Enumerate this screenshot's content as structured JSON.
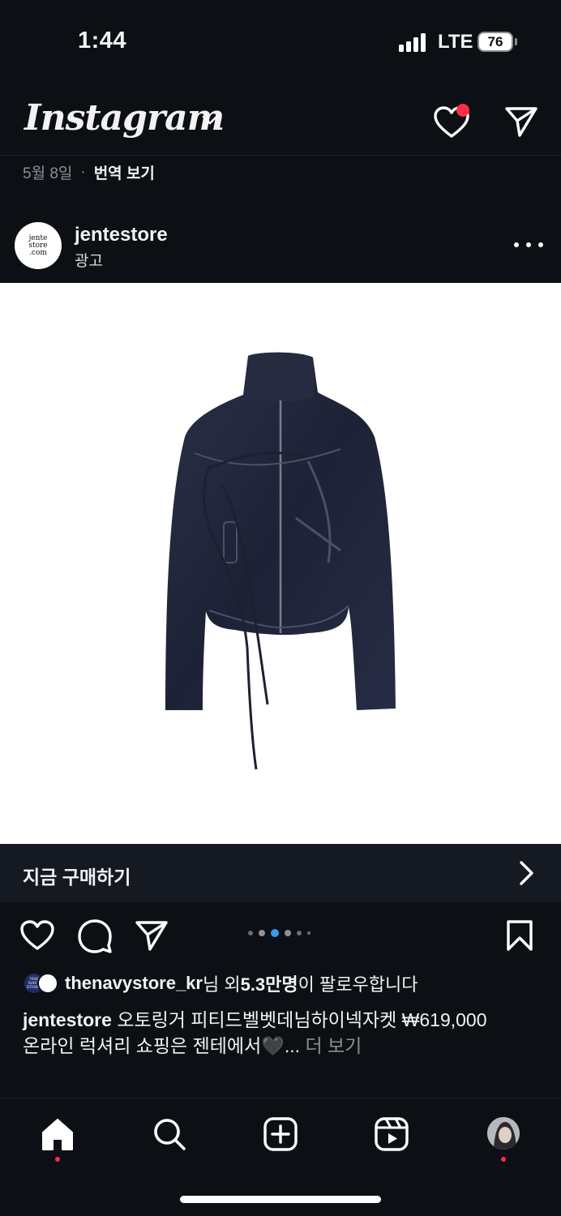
{
  "status_bar": {
    "time": "1:44",
    "network": "LTE",
    "battery": "76"
  },
  "header": {
    "logo": "Instagram",
    "notification_dot_color": "#ff2d46"
  },
  "meta": {
    "date": "5월 8일",
    "separator": "·",
    "translate": "번역 보기"
  },
  "post": {
    "username": "jentestore",
    "sponsored_label": "광고",
    "avatar_text": "jente store .com",
    "image_subject": "navy denim jacket with tie straps",
    "carousel_dots": 6,
    "carousel_active_index": 2
  },
  "cta": {
    "label": "지금 구매하기"
  },
  "followed_by": {
    "name": "thenavystore_kr",
    "suffix_1": "님 외 ",
    "count": "5.3만명",
    "suffix_2": "이 팔로우합니다",
    "mini_avatar_text": "THE NAVY STORE"
  },
  "caption": {
    "user": "jentestore",
    "line1": " 오토링거 피티드벨벳데님하이넥자켓 ₩619,000",
    "line2": "온라인 럭셔리 쇼핑은 젠테에서🖤",
    "ellipsis": "... ",
    "more": "더 보기"
  },
  "tabs": [
    "home-icon",
    "search-icon",
    "create-icon",
    "reels-icon",
    "profile-avatar"
  ],
  "colors": {
    "background": "#0c0f14",
    "cta_background": "#151922",
    "accent_red": "#ff2d46",
    "carousel_active": "#3897f0"
  }
}
